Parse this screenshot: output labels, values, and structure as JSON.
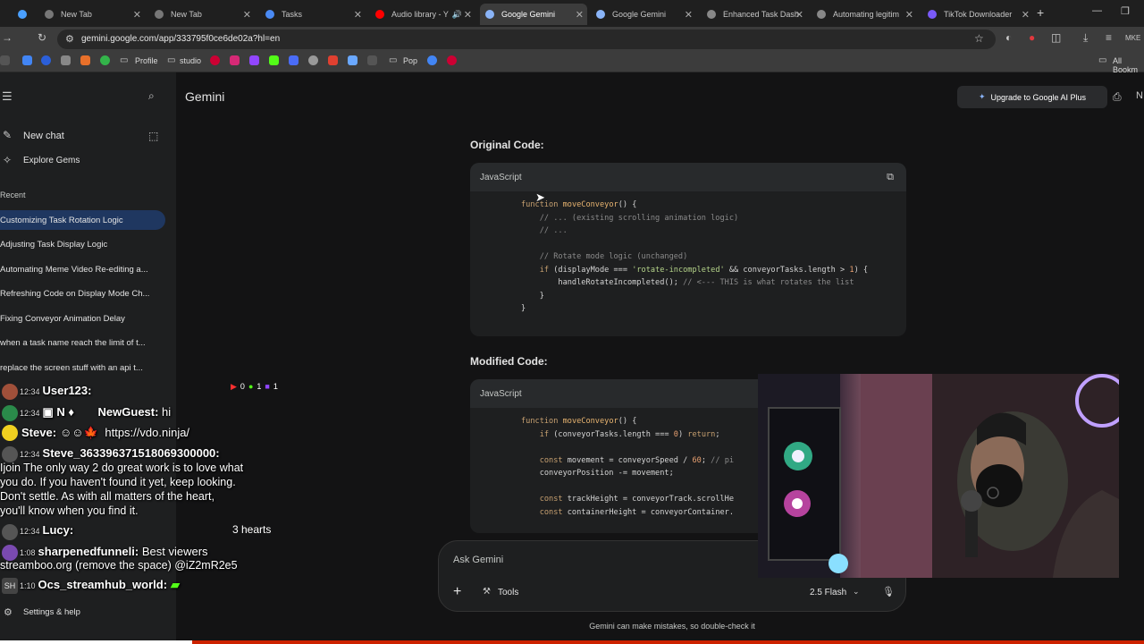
{
  "browser": {
    "tabs": [
      {
        "label": "",
        "color": "#4aa0ff"
      },
      {
        "label": "New Tab",
        "color": "#888888"
      },
      {
        "label": "New Tab",
        "color": "#888888"
      },
      {
        "label": "Tasks",
        "color": "#4a8af4"
      },
      {
        "label": "Audio library - Y",
        "color": "#ff0000"
      },
      {
        "label": "Google Gemini",
        "color": "#8ab4f8"
      },
      {
        "label": "Google Gemini",
        "color": "#8ab4f8"
      },
      {
        "label": "Enhanced Task Dash",
        "color": "#888888"
      },
      {
        "label": "Automating legitim",
        "color": "#888888"
      },
      {
        "label": "TikTok Downloader",
        "color": "#7a5af8"
      }
    ],
    "url": "gemini.google.com/app/333795f0ce6de02a?hl=en",
    "bookmarks": {
      "profile": "Profile",
      "studio": "studio",
      "pop": "Pop",
      "all_bookmarks": "All Bookm"
    }
  },
  "sidebar": {
    "new_chat": "New chat",
    "explore_gems": "Explore Gems",
    "recent_label": "Recent",
    "recent": [
      "Customizing Task Rotation Logic",
      "Adjusting Task Display Logic",
      "Automating Meme Video Re-editing a...",
      "Refreshing Code on Display Mode Ch...",
      "Fixing Conveyor Animation Delay",
      "when a task name reach the limit of t...",
      "replace the screen stuff with an api t..."
    ],
    "settings": "Settings & help"
  },
  "main": {
    "title": "Gemini",
    "upgrade": "Upgrade to Google AI Plus",
    "original_title": "Original Code:",
    "modified_title": "Modified Code:",
    "lang": "JavaScript",
    "input_placeholder": "Ask Gemini",
    "tools": "Tools",
    "model": "2.5 Flash",
    "disclaimer": "Gemini can make mistakes, so double-check it"
  },
  "chat": {
    "counts": {
      "red": "0",
      "green": "1",
      "purple": "1"
    },
    "messages": [
      {
        "time": "12:34",
        "user": "User123:",
        "text": ""
      },
      {
        "time": "12:34",
        "user": "NewGuest:",
        "text": " hi"
      },
      {
        "time": "",
        "user": "Steve:",
        "text": " https://vdo.ninja/"
      },
      {
        "time": "12:34",
        "user": "Steve_363396371518069300000:",
        "text": ""
      },
      {
        "time": "",
        "user": "",
        "text": "Ijoin The only way 2 do great work is to love what"
      },
      {
        "time": "",
        "user": "",
        "text": "you do. If you haven't found it yet, keep looking."
      },
      {
        "time": "",
        "user": "",
        "text": "Don't settle. As with all matters of the heart,"
      },
      {
        "time": "",
        "user": "",
        "text": "you'll know when you find it."
      },
      {
        "time": "12:34",
        "user": "Lucy:",
        "text": ""
      },
      {
        "time": "1:08",
        "user": "sharpenedfunneli:",
        "text": " Best viewers"
      },
      {
        "time": "",
        "user": "",
        "text": "streamboo.org (remove the space) @iZ2mR2e5"
      },
      {
        "time": "1:10",
        "user": "Ocs_streamhub_world:",
        "text": ""
      }
    ],
    "hearts": "3 hearts"
  }
}
